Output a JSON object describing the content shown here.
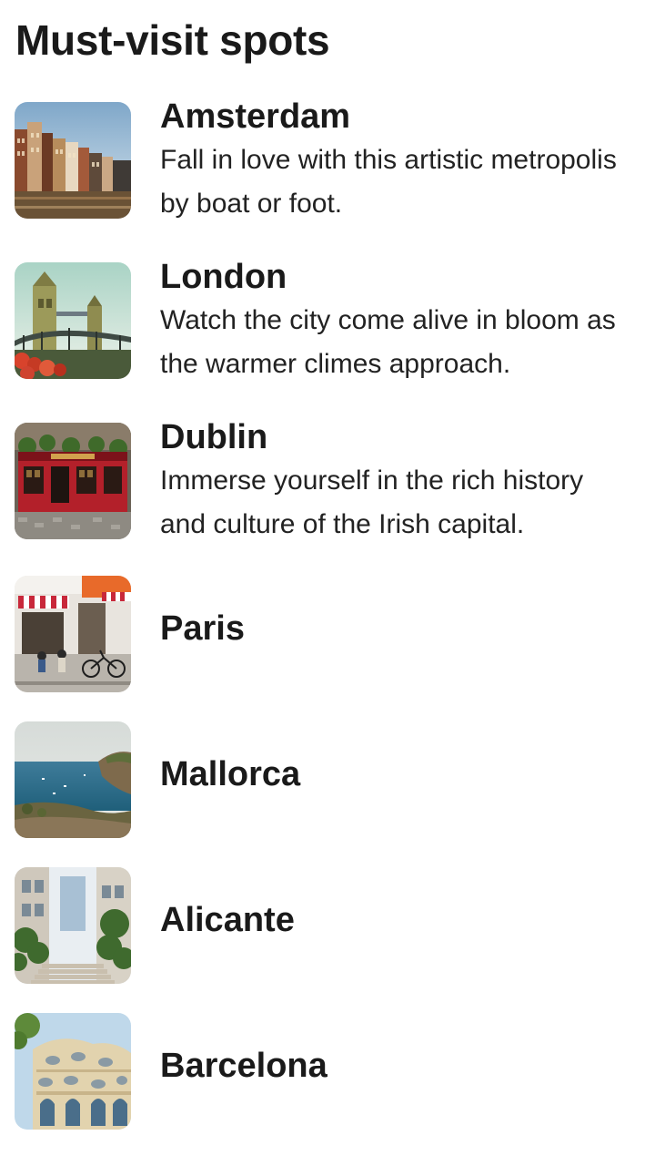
{
  "page": {
    "title": "Must-visit spots"
  },
  "spots": [
    {
      "name": "Amsterdam",
      "description": "Fall in love with this artistic metropolis by boat or foot.",
      "image": "amsterdam-canal-houses-photo"
    },
    {
      "name": "London",
      "description": "Watch the city come alive in bloom as the warmer climes approach.",
      "image": "london-tower-bridge-photo"
    },
    {
      "name": "Dublin",
      "description": "Immerse yourself in the rich history and culture of the Irish capital.",
      "image": "dublin-red-pub-photo"
    },
    {
      "name": "Paris",
      "description": "",
      "image": "paris-cafe-street-photo"
    },
    {
      "name": "Mallorca",
      "description": "",
      "image": "mallorca-coast-photo"
    },
    {
      "name": "Alicante",
      "description": "",
      "image": "alicante-alley-stairs-photo"
    },
    {
      "name": "Barcelona",
      "description": "",
      "image": "barcelona-casa-batllo-photo"
    }
  ],
  "colors": {
    "text": "#1a1a1a",
    "background": "#ffffff"
  }
}
